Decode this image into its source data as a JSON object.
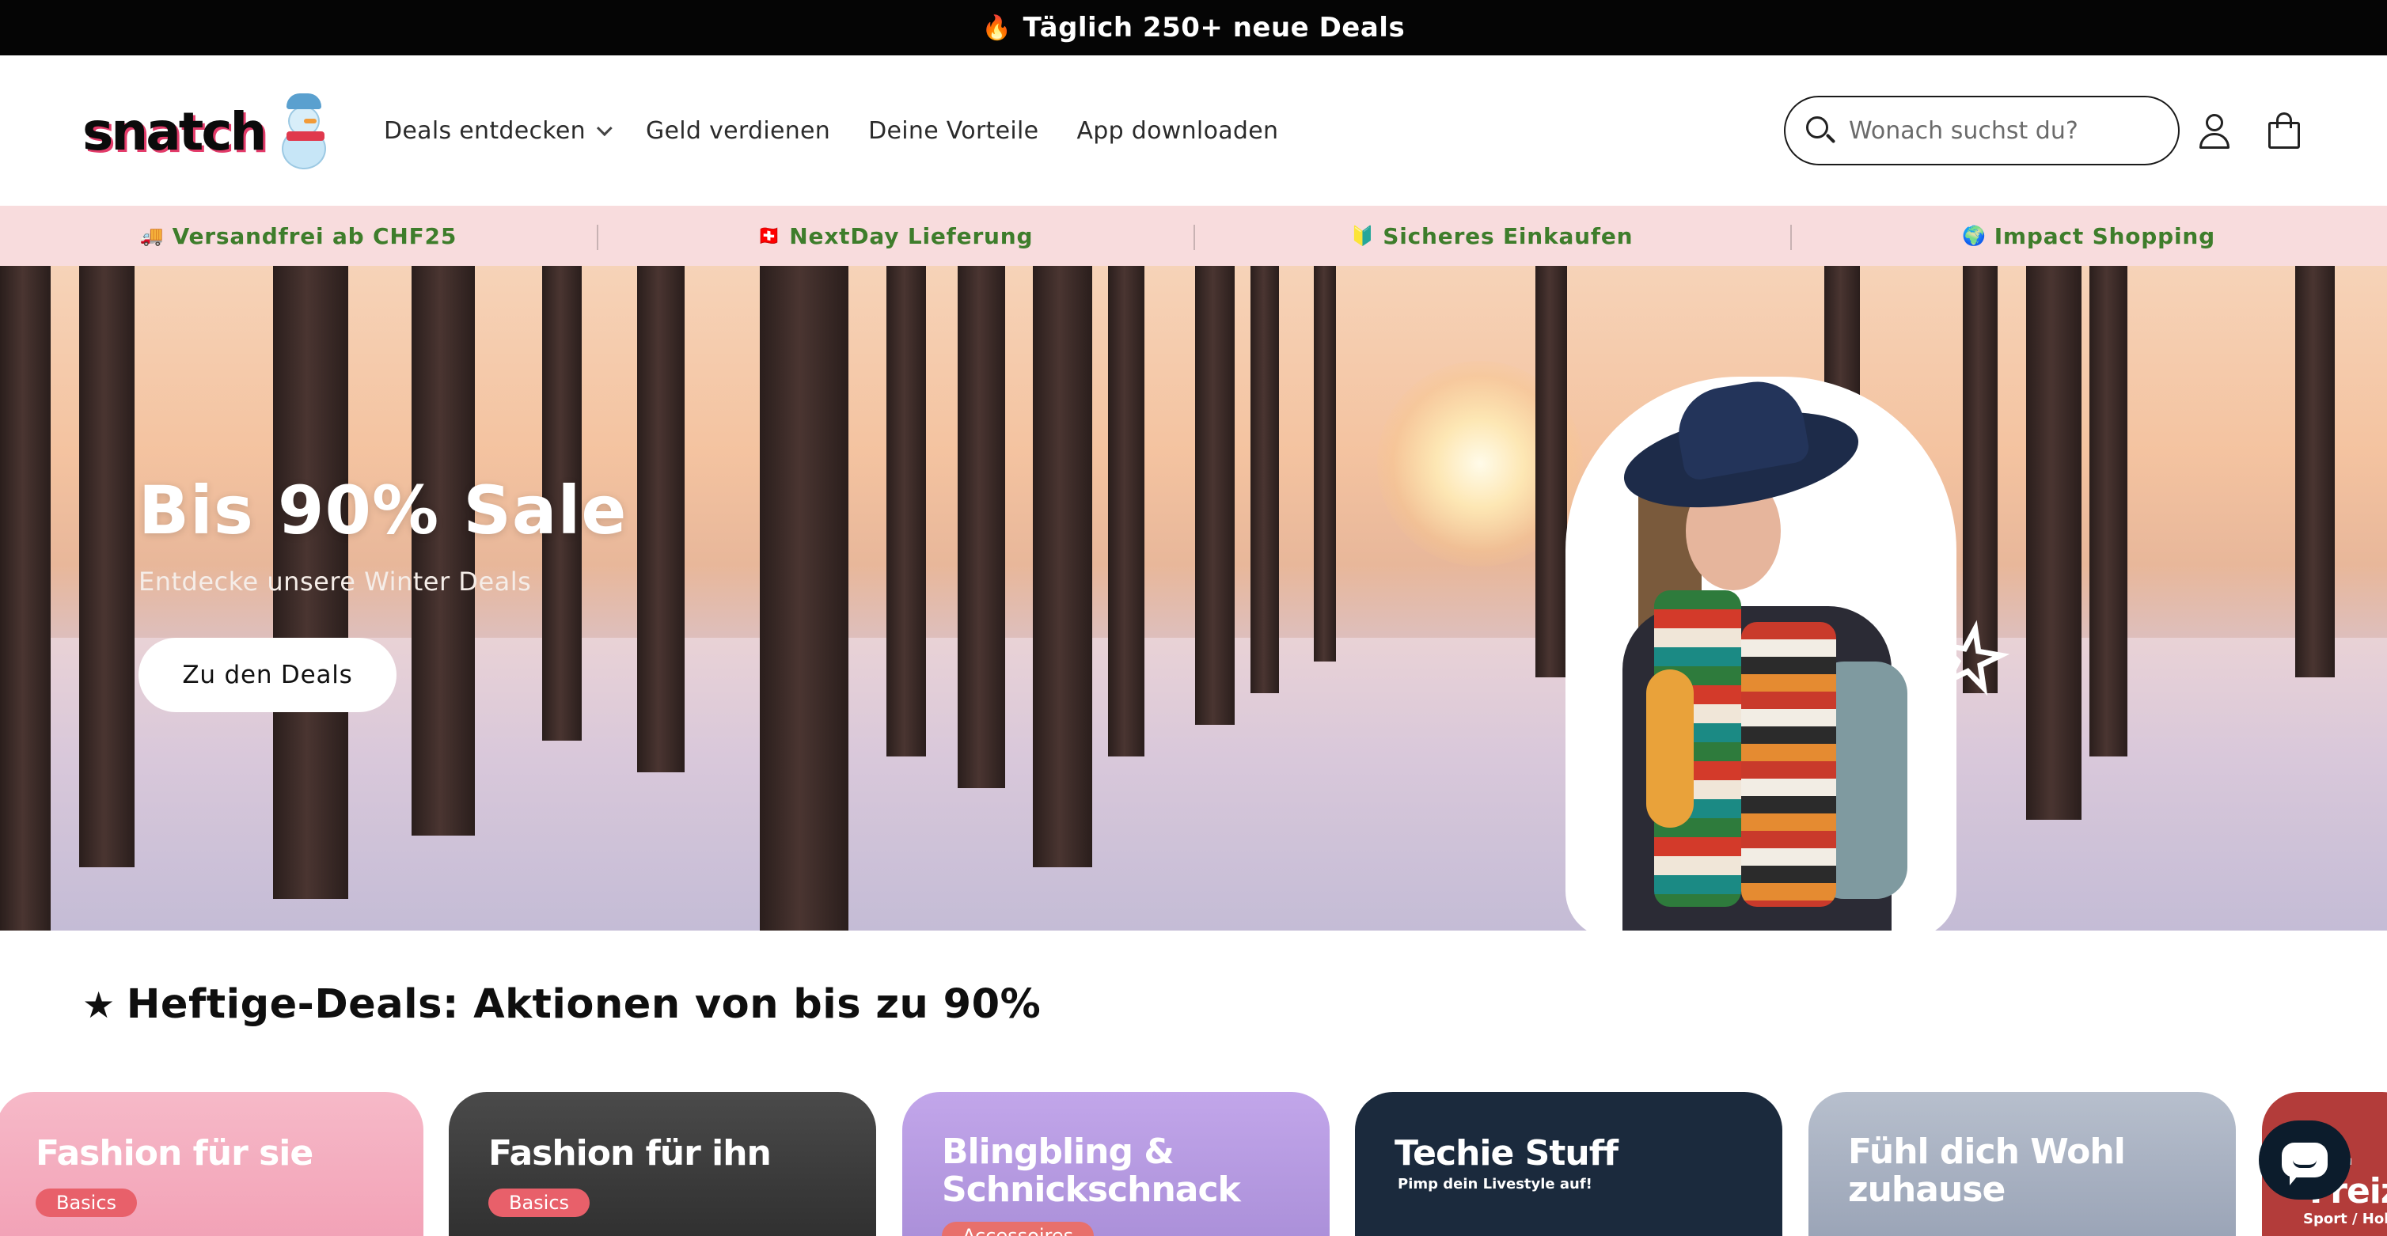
{
  "announcement": {
    "icon": "fire-icon",
    "icon_glyph": "🔥",
    "text": "Täglich 250+ neue Deals"
  },
  "header": {
    "logo_text": "snatch",
    "nav": [
      {
        "label": "Deals entdecken",
        "has_dropdown": true
      },
      {
        "label": "Geld verdienen"
      },
      {
        "label": "Deine Vorteile"
      },
      {
        "label": "App downloaden"
      }
    ],
    "search": {
      "placeholder": "Wonach suchst du?",
      "value": ""
    }
  },
  "usp": [
    {
      "icon": "truck-icon",
      "glyph": "🚚",
      "label": "Versandfrei ab CHF25"
    },
    {
      "icon": "swiss-flag-icon",
      "glyph": "🇨🇭",
      "label": "NextDay Lieferung"
    },
    {
      "icon": "beginner-badge-icon",
      "glyph": "🔰",
      "label": "Sicheres Einkaufen"
    },
    {
      "icon": "globe-icon",
      "glyph": "🌍",
      "label": "Impact Shopping"
    }
  ],
  "hero": {
    "title": "Bis 90% Sale",
    "subtitle": "Entdecke unsere Winter Deals",
    "cta": "Zu den Deals"
  },
  "section": {
    "title": "Heftige-Deals: Aktionen von bis zu 90%",
    "icon_glyph": "★"
  },
  "cards": [
    {
      "title": "Fashion für sie",
      "badge": "Basics",
      "sub": "",
      "bg": "#f3a7b8"
    },
    {
      "title": "Fashion für ihn",
      "badge": "Basics",
      "sub": "",
      "bg": "#3a3a3a"
    },
    {
      "title": "Blingbling & Schnickschnack",
      "badge": "Accessoires",
      "sub": "",
      "bg": "#b79ce0"
    },
    {
      "title": "Techie Stuff",
      "badge": "",
      "sub": "Pimp dein Livestyle auf!",
      "bg": "#1b2a3d"
    },
    {
      "title": "Fühl dich Wohl zuhause",
      "badge": "",
      "sub": "",
      "bg": "#a9b2c2"
    },
    {
      "title": "Fr. Freiz",
      "badge": "",
      "sub": "Sport / Hob",
      "bg": "#b33c3a"
    }
  ],
  "colors": {
    "accent_green": "#3e7d2b",
    "usp_bg": "#f8dcdd",
    "announcement_bg": "#050505"
  }
}
